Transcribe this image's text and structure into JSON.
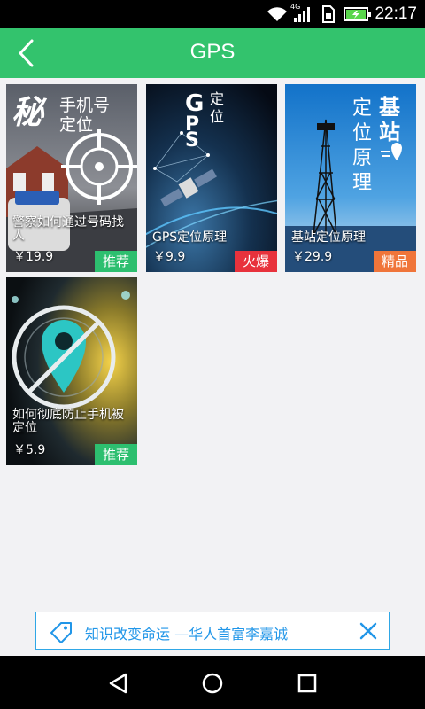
{
  "status_bar": {
    "time": "22:17",
    "network": "4G",
    "icons": [
      "wifi-icon",
      "cell-signal-icon",
      "sim-icon",
      "battery-icon"
    ]
  },
  "header": {
    "title": "GPS",
    "back_icon": "chevron-left-icon",
    "background": "#33c36d"
  },
  "products": [
    {
      "name": "警察如何通过号码找人",
      "price": "￥19.9",
      "badge": "推荐",
      "badge_color": "#2dbf6f",
      "art_text": [
        "秘",
        "手机号",
        "定位"
      ]
    },
    {
      "name": "GPS定位原理",
      "price": "￥9.9",
      "badge": "火爆",
      "badge_color": "#e8323c",
      "art_text": [
        "G",
        "P",
        "S",
        "定",
        "位"
      ]
    },
    {
      "name": "基站定位原理",
      "price": "￥29.9",
      "badge": "精品",
      "badge_color": "#f0753a",
      "art_text": [
        "定",
        "位",
        "原",
        "理",
        "基",
        "站"
      ]
    },
    {
      "name": "如何彻底防止手机被定位",
      "price": "￥5.9",
      "badge": "推荐",
      "badge_color": "#2dbf6f",
      "art_text": []
    }
  ],
  "promo_banner": {
    "text": "知识改变命运 —华人首富李嘉诚",
    "tag_icon": "tag-icon",
    "close_icon": "close-icon",
    "accent": "#2196e8"
  },
  "nav_bar": {
    "icons": [
      "back-triangle-icon",
      "home-circle-icon",
      "recents-square-icon"
    ]
  }
}
